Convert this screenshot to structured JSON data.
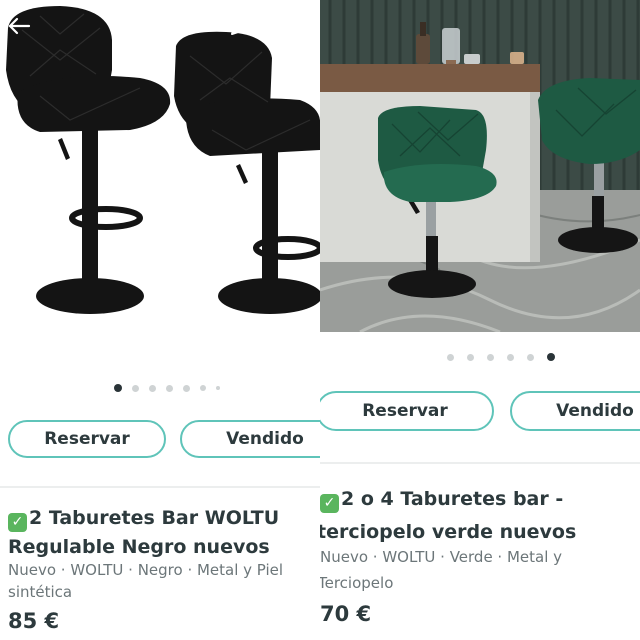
{
  "listings": [
    {
      "title_line1": "2 Taburetes Bar WOLTU",
      "title_line2": "Regulable Negro nuevos",
      "meta_line1": "Nuevo · WOLTU · Negro · Metal y Piel",
      "meta_line2": "sintética",
      "price": "85 €",
      "reserve_label": "Reservar",
      "sold_label": "Vendido",
      "image_count": 7,
      "active_image": 1,
      "photo_subject": "black-bar-stools"
    },
    {
      "title_line1": "2 o 4 Taburetes bar -",
      "title_line2": "terciopelo verde nuevos",
      "meta_line1": "Nuevo · WOLTU · Verde · Metal y",
      "meta_line2": "Terciopelo",
      "price": "70 €",
      "reserve_label": "Reservar",
      "sold_label": "Vendido",
      "image_count": 6,
      "active_image": 6,
      "photo_subject": "green-velvet-bar-stools"
    }
  ],
  "icons": [
    "back-arrow-icon",
    "edit-pencil-icon",
    "share-icon",
    "checkmark-icon"
  ],
  "colors": {
    "accent": "#5fc4b9",
    "text": "#2d3a3d",
    "muted": "#6c7679",
    "check": "#5ab55e",
    "stool_black": "#141414",
    "stool_green": "#1e5a43"
  }
}
